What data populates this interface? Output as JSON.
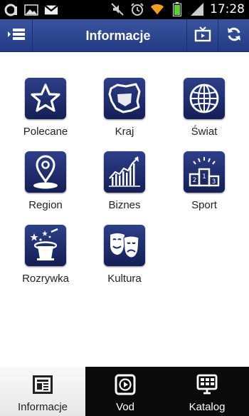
{
  "status_bar": {
    "time": "17:28",
    "icons": [
      "sync-icon",
      "gallery-icon",
      "gmail-icon",
      "mute-icon",
      "alarm-icon",
      "wifi-icon",
      "battery-icon",
      "signal-icon"
    ]
  },
  "header": {
    "title": "Informacje",
    "menu_icon": "menu-icon",
    "tv_icon": "tv-icon",
    "refresh_icon": "refresh-icon"
  },
  "categories": [
    {
      "label": "Polecane",
      "icon": "star-icon"
    },
    {
      "label": "Kraj",
      "icon": "poland-map-icon"
    },
    {
      "label": "Świat",
      "icon": "globe-icon"
    },
    {
      "label": "Region",
      "icon": "map-pin-icon"
    },
    {
      "label": "Biznes",
      "icon": "stock-chart-icon"
    },
    {
      "label": "Sport",
      "icon": "podium-icon"
    },
    {
      "label": "Rozrywka",
      "icon": "magic-hat-icon"
    },
    {
      "label": "Kultura",
      "icon": "theater-masks-icon"
    }
  ],
  "tabs": [
    {
      "label": "Informacje",
      "icon": "newspaper-icon",
      "active": true
    },
    {
      "label": "Vod",
      "icon": "play-icon",
      "active": false
    },
    {
      "label": "Katalog",
      "icon": "tv-grid-icon",
      "active": false
    }
  ],
  "colors": {
    "action_bar": "#2d4690",
    "tile_background": "#1f2d6e",
    "tab_bar_dark": "#0a0a0a"
  }
}
